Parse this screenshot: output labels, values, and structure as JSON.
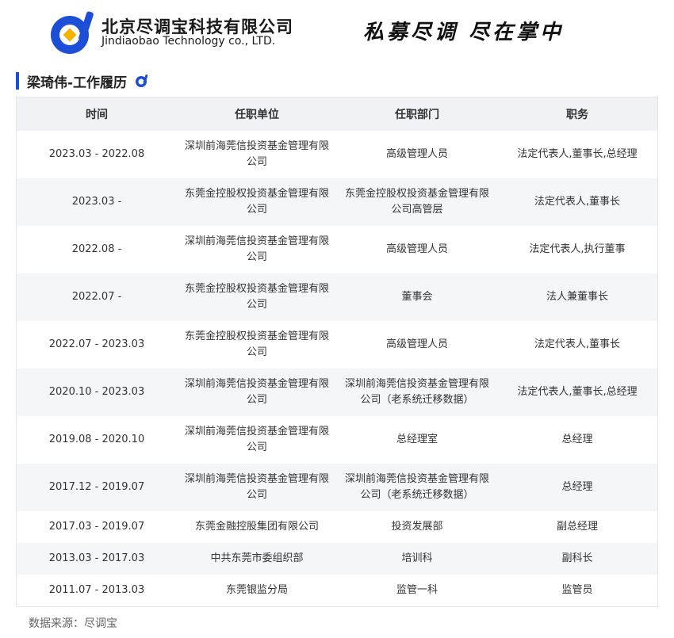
{
  "header": {
    "company_cn": "北京尽调宝科技有限公司",
    "company_en": "Jindiaobao Technology co., LTD.",
    "slogan": "私募尽调  尽在掌中",
    "brand_color": "#1d4ed8",
    "accent_color": "#f5b300"
  },
  "section": {
    "title": "梁琦伟-工作履历",
    "icon": "jindiaobao-logo-icon"
  },
  "table": {
    "headers": [
      "时间",
      "任职单位",
      "任职部门",
      "职务"
    ],
    "rows": [
      {
        "time": "2023.03 - 2022.08",
        "company": "深圳前海莞信投资基金管理有限公司",
        "dept": "高级管理人员",
        "title": "法定代表人,董事长,总经理"
      },
      {
        "time": "2023.03 -",
        "company": "东莞金控股权投资基金管理有限公司",
        "dept": "东莞金控股权投资基金管理有限公司高管层",
        "title": "法定代表人,董事长"
      },
      {
        "time": "2022.08 -",
        "company": "深圳前海莞信投资基金管理有限公司",
        "dept": "高级管理人员",
        "title": "法定代表人,执行董事"
      },
      {
        "time": "2022.07 -",
        "company": "东莞金控股权投资基金管理有限公司",
        "dept": "董事会",
        "title": "法人兼董事长"
      },
      {
        "time": "2022.07 - 2023.03",
        "company": "东莞金控股权投资基金管理有限公司",
        "dept": "高级管理人员",
        "title": "法定代表人,董事长"
      },
      {
        "time": "2020.10 - 2023.03",
        "company": "深圳前海莞信投资基金管理有限公司",
        "dept": "深圳前海莞信投资基金管理有限公司（老系统迁移数据）",
        "title": "法定代表人,董事长,总经理"
      },
      {
        "time": "2019.08 - 2020.10",
        "company": "深圳前海莞信投资基金管理有限公司",
        "dept": "总经理室",
        "title": "总经理"
      },
      {
        "time": "2017.12 - 2019.07",
        "company": "深圳前海莞信投资基金管理有限公司",
        "dept": "深圳前海莞信投资基金管理有限公司（老系统迁移数据）",
        "title": "总经理"
      },
      {
        "time": "2017.03 - 2019.07",
        "company": "东莞金融控股集团有限公司",
        "dept": "投资发展部",
        "title": "副总经理"
      },
      {
        "time": "2013.03 - 2017.03",
        "company": "中共东莞市委组织部",
        "dept": "培训科",
        "title": "副科长"
      },
      {
        "time": "2011.07 - 2013.03",
        "company": "东莞银监分局",
        "dept": "监管一科",
        "title": "监管员"
      }
    ]
  },
  "footer": {
    "source": "数据来源：尽调宝"
  }
}
